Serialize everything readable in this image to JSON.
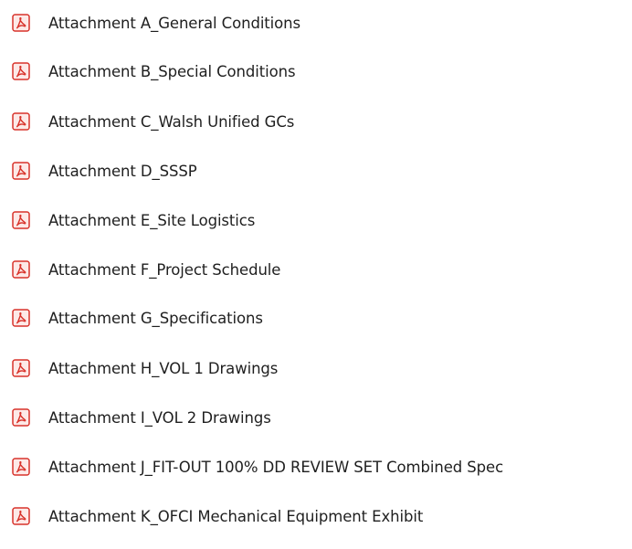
{
  "icon": "pdf-document-icon",
  "icon_color": "#d8332b",
  "files": [
    {
      "name": "Attachment A_General Conditions"
    },
    {
      "name": "Attachment B_Special Conditions"
    },
    {
      "name": "Attachment C_Walsh Unified GCs"
    },
    {
      "name": "Attachment D_SSSP"
    },
    {
      "name": "Attachment E_Site Logistics"
    },
    {
      "name": "Attachment F_Project Schedule"
    },
    {
      "name": "Attachment G_Specifications"
    },
    {
      "name": "Attachment H_VOL 1 Drawings"
    },
    {
      "name": "Attachment I_VOL 2 Drawings"
    },
    {
      "name": "Attachment J_FIT-OUT 100% DD REVIEW SET Combined Spec"
    },
    {
      "name": "Attachment K_OFCI Mechanical Equipment Exhibit"
    }
  ]
}
